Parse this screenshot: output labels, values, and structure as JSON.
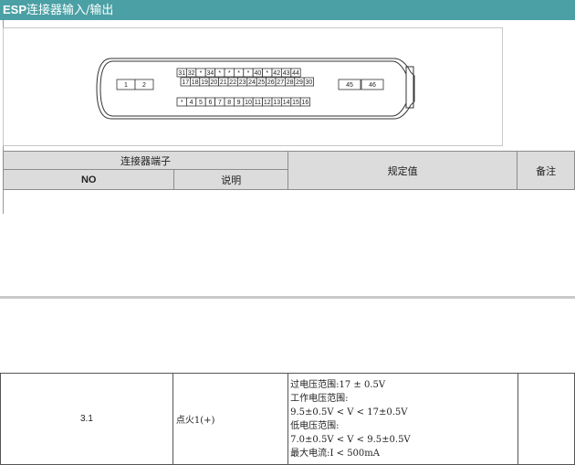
{
  "header": {
    "title_bold": "ESP",
    "title_rest": "连接器输入/输出"
  },
  "connector": {
    "left_pins": [
      "1",
      "2"
    ],
    "right_pins": [
      "45",
      "46"
    ],
    "top_row": [
      "31",
      "32",
      "*",
      "34",
      "*",
      "*",
      "*",
      "*",
      "40",
      "*",
      "42",
      "43",
      "44"
    ],
    "middle_row": [
      "17",
      "18",
      "19",
      "20",
      "21",
      "22",
      "23",
      "24",
      "25",
      "26",
      "27",
      "28",
      "29",
      "30"
    ],
    "bottom_row": [
      "*",
      "4",
      "5",
      "6",
      "7",
      "8",
      "9",
      "10",
      "11",
      "12",
      "13",
      "14",
      "15",
      "16"
    ]
  },
  "table_header": {
    "connector_terminal": "连接器端子",
    "spec": "规定值",
    "note": "备注",
    "no": "NO",
    "desc": "说明"
  },
  "rows": [
    {
      "no": "3.1",
      "desc": "点火1(+)",
      "spec": [
        "过电压范围:17 ± 0.5V",
        "工作电压范围:",
        "9.5±0.5V < V < 17±0.5V",
        "低电压范围:",
        "7.0±0.5V < V < 9.5±0.5V",
        "最大电流:I < 500mA"
      ],
      "note": ""
    }
  ]
}
